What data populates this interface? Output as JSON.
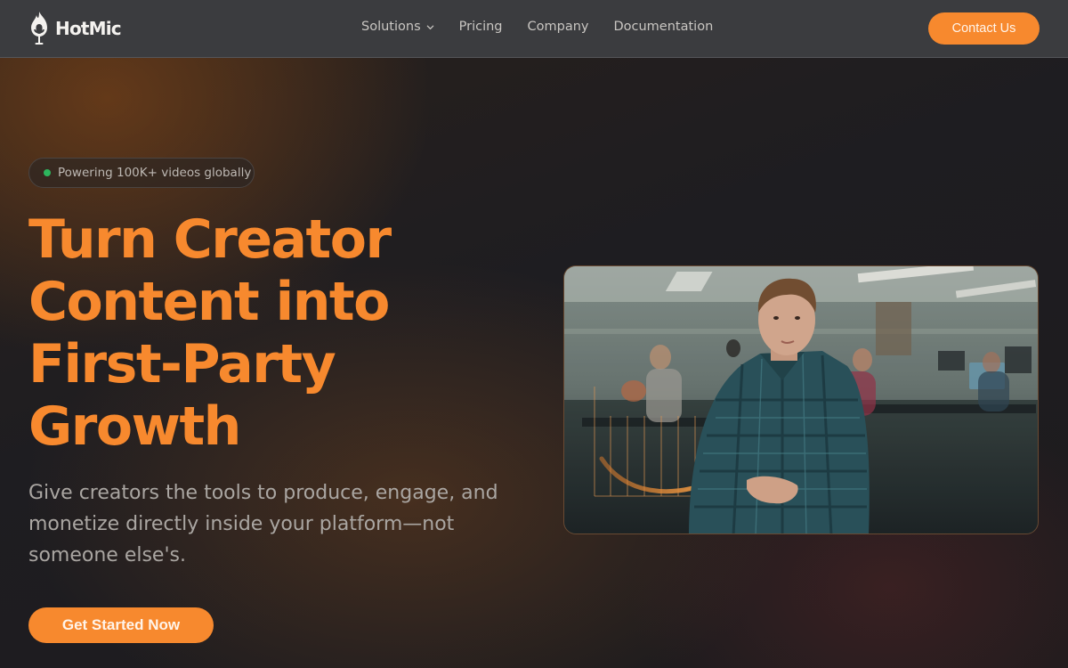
{
  "brand": {
    "name": "HotMic",
    "accent": "#f7892e"
  },
  "nav": {
    "links": [
      {
        "label": "Solutions",
        "has_dropdown": true
      },
      {
        "label": "Pricing"
      },
      {
        "label": "Company"
      },
      {
        "label": "Documentation"
      }
    ],
    "contact_label": "Contact Us"
  },
  "hero": {
    "badge": "Powering 100K+ videos globally",
    "headline_lines": [
      "Turn Creator",
      "Content into",
      "First-Party",
      "Growth"
    ],
    "subhead_lines": [
      "Give creators the tools to produce, engage, and",
      "monetize directly inside your platform—not",
      "someone else's."
    ],
    "cta_label": "Get Started Now"
  },
  "icons": {
    "logo": "flame-mic-icon",
    "dropdown": "chevron-down-icon",
    "status": "status-dot-icon"
  }
}
